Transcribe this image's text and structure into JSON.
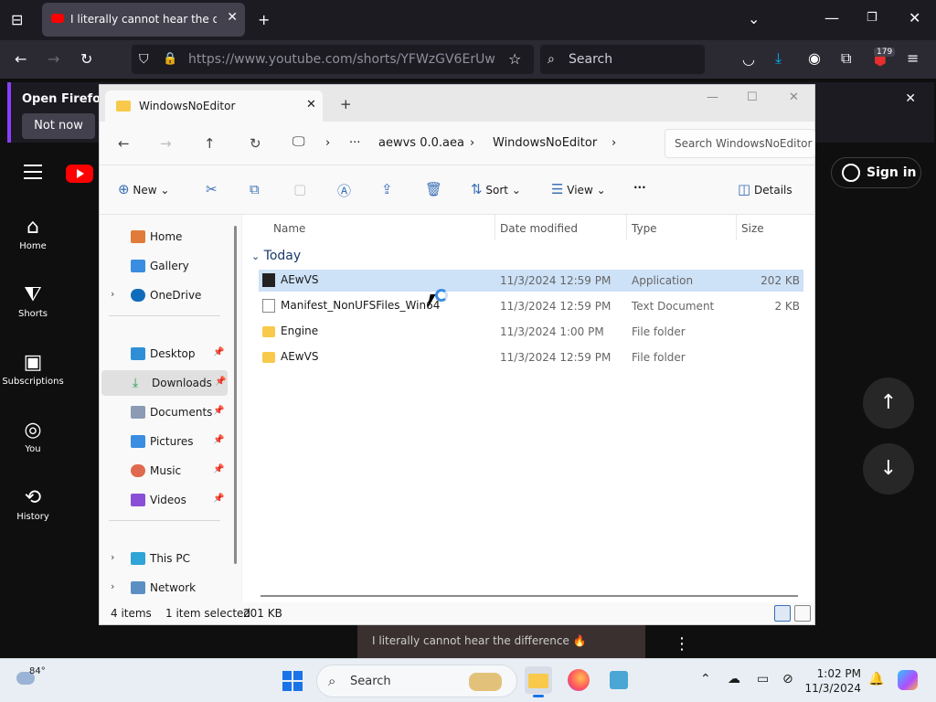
{
  "browser": {
    "tab_title": "I literally cannot hear the difference",
    "url": "https://www.youtube.com/shorts/YFWzGV6ErUw",
    "search_placeholder": "Search",
    "extension_badge": "179",
    "notification": {
      "message": "Open Firefox ev",
      "button": "Not now"
    }
  },
  "youtube": {
    "sidebar": [
      {
        "label": "Home",
        "icon": "home-icon"
      },
      {
        "label": "Shorts",
        "icon": "shorts-icon"
      },
      {
        "label": "Subscriptions",
        "icon": "subscriptions-icon"
      },
      {
        "label": "You",
        "icon": "you-icon"
      },
      {
        "label": "History",
        "icon": "history-icon"
      }
    ],
    "sign_in": "Sign in",
    "video_caption": "I literally cannot hear the difference 🔥"
  },
  "explorer": {
    "tab_title": "WindowsNoEditor",
    "breadcrumb": [
      "aewvs 0.0.aea",
      "WindowsNoEditor"
    ],
    "search_placeholder": "Search WindowsNoEditor",
    "commands": {
      "new": "New",
      "sort": "Sort",
      "view": "View",
      "details": "Details"
    },
    "nav": [
      {
        "label": "Home",
        "chevron": false,
        "pinned": false
      },
      {
        "label": "Gallery",
        "chevron": false,
        "pinned": false
      },
      {
        "label": "OneDrive",
        "chevron": true,
        "pinned": false
      },
      {
        "label": "Desktop",
        "chevron": false,
        "pinned": true
      },
      {
        "label": "Downloads",
        "chevron": false,
        "pinned": true
      },
      {
        "label": "Documents",
        "chevron": false,
        "pinned": true
      },
      {
        "label": "Pictures",
        "chevron": false,
        "pinned": true
      },
      {
        "label": "Music",
        "chevron": false,
        "pinned": true
      },
      {
        "label": "Videos",
        "chevron": false,
        "pinned": true
      },
      {
        "label": "This PC",
        "chevron": true,
        "pinned": false
      },
      {
        "label": "Network",
        "chevron": true,
        "pinned": false
      }
    ],
    "columns": {
      "name": "Name",
      "date": "Date modified",
      "type": "Type",
      "size": "Size"
    },
    "group": "Today",
    "files": [
      {
        "name": "AEwVS",
        "date": "11/3/2024 12:59 PM",
        "type": "Application",
        "size": "202 KB"
      },
      {
        "name": "Manifest_NonUFSFiles_Win64",
        "date": "11/3/2024 12:59 PM",
        "type": "Text Document",
        "size": "2 KB"
      },
      {
        "name": "Engine",
        "date": "11/3/2024 1:00 PM",
        "type": "File folder",
        "size": ""
      },
      {
        "name": "AEwVS",
        "date": "11/3/2024 12:59 PM",
        "type": "File folder",
        "size": ""
      }
    ],
    "status": {
      "count": "4 items",
      "selection": "1 item selected",
      "size": "201 KB"
    }
  },
  "taskbar": {
    "weather": "84°",
    "search": "Search",
    "time": "1:02 PM",
    "date": "11/3/2024"
  }
}
